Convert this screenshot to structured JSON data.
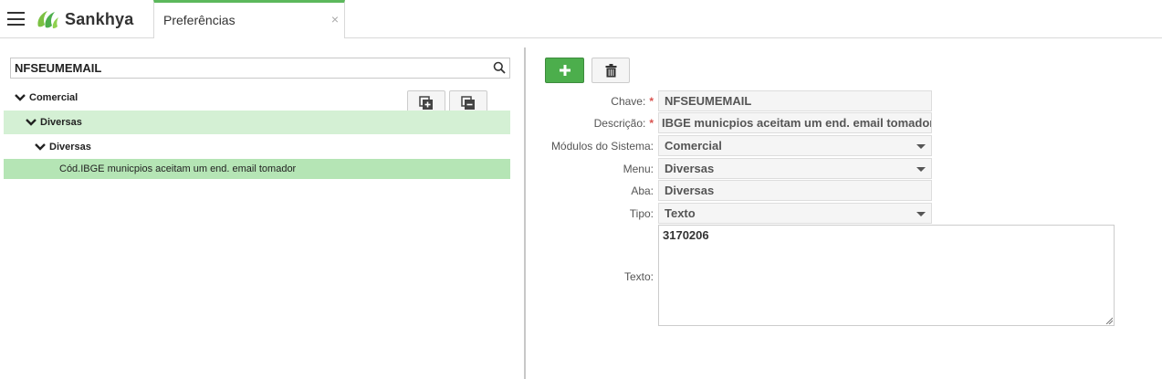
{
  "header": {
    "logo_text": "Sankhya",
    "tab_label": "Preferências",
    "tab_close": "×"
  },
  "search": {
    "value": "NFSEUMEMAIL"
  },
  "tree": {
    "items": [
      {
        "label": "Comercial",
        "level": 0
      },
      {
        "label": "Diversas",
        "level": 1
      },
      {
        "label": "Diversas",
        "level": 2
      },
      {
        "label": "Cód.IBGE municpios aceitam um end. email tomador",
        "level": 3
      }
    ]
  },
  "form": {
    "chave_label": "Chave:",
    "chave_value": "NFSEUMEMAIL",
    "descricao_label": "Descrição:",
    "descricao_value": "IBGE municpios aceitam um end. email tomador",
    "required_mark": "*",
    "modulos_label": "Módulos do Sistema:",
    "modulos_value": "Comercial",
    "menu_label": "Menu:",
    "menu_value": "Diversas",
    "aba_label": "Aba:",
    "aba_value": "Diversas",
    "tipo_label": "Tipo:",
    "tipo_value": "Texto",
    "texto_label": "Texto:",
    "texto_value": "3170206"
  },
  "colors": {
    "accent_green": "#4cae4c",
    "selection_light": "#d4f0d4",
    "selection_strong": "#b5e5b5",
    "required_red": "#d9534f"
  },
  "icons": {
    "menu": "hamburger-icon",
    "logo": "sankhya-logo-icon",
    "search": "search-icon",
    "expand_all": "expand-all-icon",
    "collapse_all": "collapse-all-icon",
    "add": "plus-icon",
    "delete": "trash-icon"
  }
}
